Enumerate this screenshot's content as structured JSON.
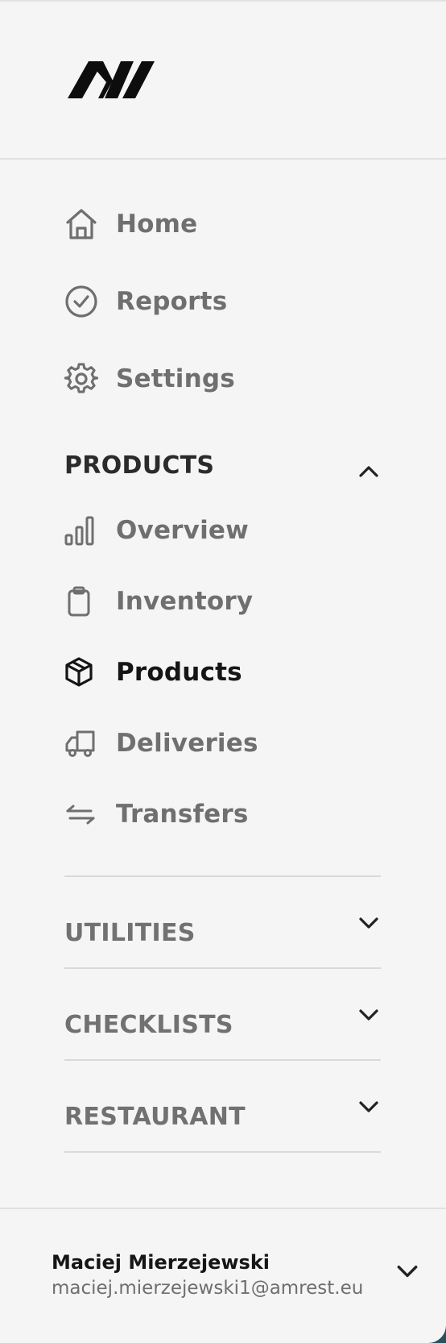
{
  "brand": {
    "logo_text": "AW"
  },
  "nav": {
    "primary": [
      {
        "label": "Home",
        "icon": "home-icon"
      },
      {
        "label": "Reports",
        "icon": "check-circle-icon"
      },
      {
        "label": "Settings",
        "icon": "gear-icon"
      }
    ],
    "sections": [
      {
        "title": "PRODUCTS",
        "expanded": true,
        "items": [
          {
            "label": "Overview",
            "icon": "bar-chart-icon"
          },
          {
            "label": "Inventory",
            "icon": "clipboard-icon"
          },
          {
            "label": "Products",
            "icon": "box-icon",
            "active": true
          },
          {
            "label": "Deliveries",
            "icon": "truck-icon"
          },
          {
            "label": "Transfers",
            "icon": "arrows-swap-icon"
          }
        ]
      },
      {
        "title": "UTILITIES",
        "expanded": false
      },
      {
        "title": "CHECKLISTS",
        "expanded": false
      },
      {
        "title": "RESTAURANT",
        "expanded": false
      }
    ]
  },
  "user": {
    "name": "Maciej Mierzejewski",
    "email": "maciej.mierzejewski1@amrest.eu"
  },
  "colors": {
    "sidebar_bg": "#f5f5f5",
    "text_muted": "#6f6f6f",
    "text_active": "#151515",
    "divider": "#d9d9d9"
  }
}
